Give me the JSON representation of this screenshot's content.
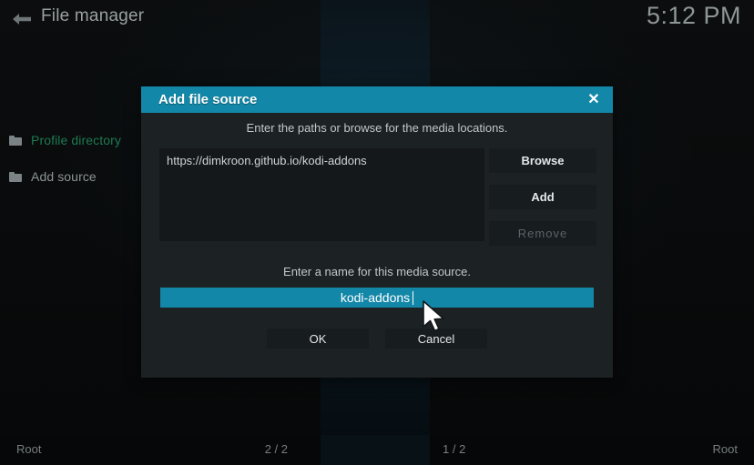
{
  "window": {
    "title": "File manager",
    "clock": "5:12 PM",
    "back_icon": "back-arrow-icon"
  },
  "sidebar": {
    "items": [
      {
        "label": "Profile directory",
        "icon": "folder-icon",
        "selected": true
      },
      {
        "label": "Add source",
        "icon": "folder-icon",
        "selected": false
      }
    ]
  },
  "status_bar": {
    "left_label": "Root",
    "left_count": "2 / 2",
    "right_count": "1 / 2",
    "right_label": "Root"
  },
  "dialog": {
    "title": "Add file source",
    "close_icon": "✕",
    "subtitle": "Enter the paths or browse for the media locations.",
    "paths": [
      "https://dimkroon.github.io/kodi-addons"
    ],
    "side_buttons": [
      {
        "label": "Browse",
        "enabled": true
      },
      {
        "label": "Add",
        "enabled": true
      },
      {
        "label": "Remove",
        "enabled": false
      }
    ],
    "name_label": "Enter a name for this media source.",
    "name_value": "kodi-addons",
    "action_buttons": [
      {
        "label": "OK"
      },
      {
        "label": "Cancel"
      }
    ]
  },
  "colors": {
    "accent": "#1387a8",
    "dialog_bg": "#1c2124",
    "listbox_bg": "#14181a",
    "button_bg": "#171c1f",
    "selected_text": "#1d7a52",
    "normal_text": "#8e9496"
  }
}
